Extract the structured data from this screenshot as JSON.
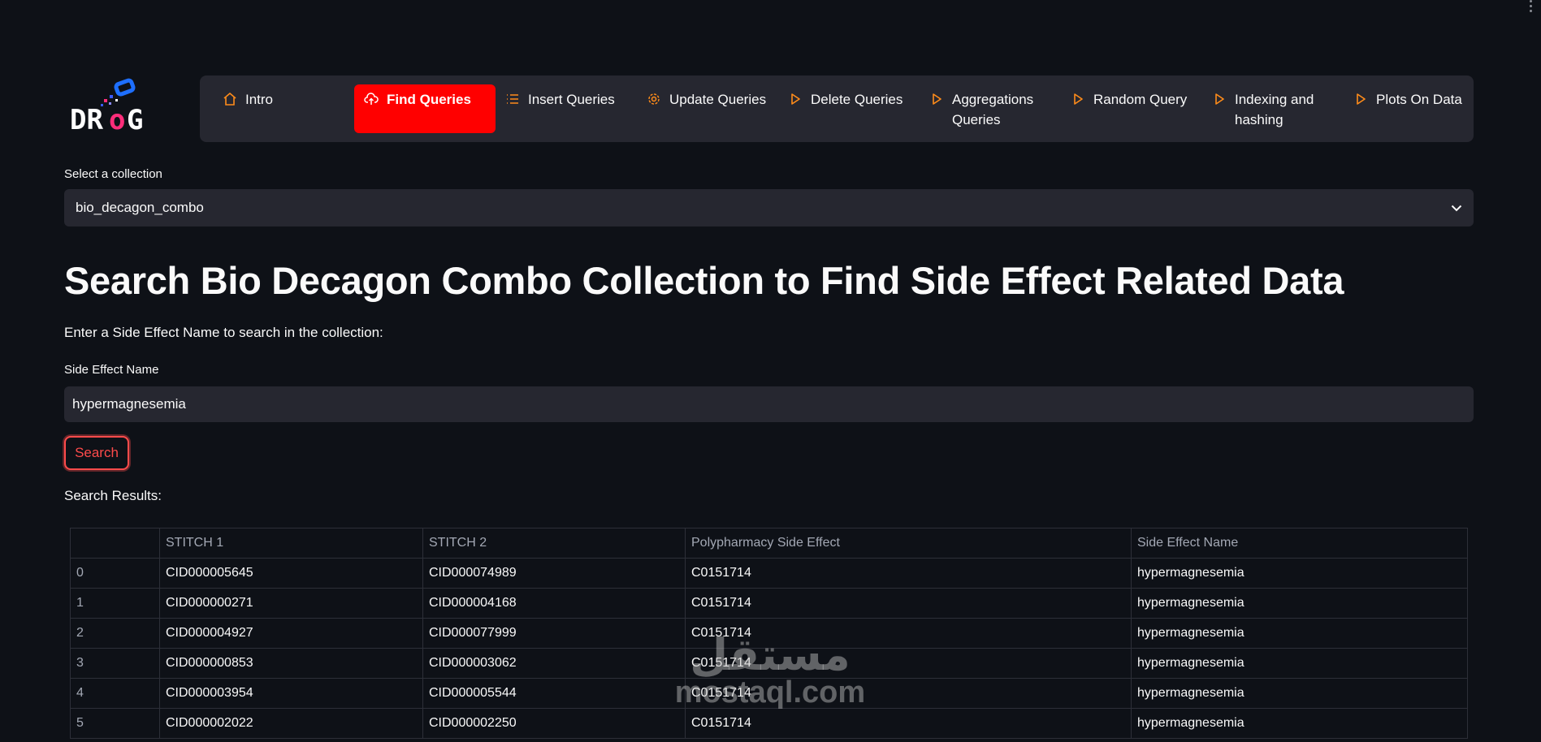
{
  "logo": {
    "text": "DRoG"
  },
  "nav": {
    "items": [
      {
        "label": "Intro",
        "icon": "house-icon",
        "active": false
      },
      {
        "label": "Find Queries",
        "icon": "cloud-upload-icon",
        "active": true
      },
      {
        "label": "Insert Queries",
        "icon": "list-icon",
        "active": false
      },
      {
        "label": "Update Queries",
        "icon": "gear-icon",
        "active": false
      },
      {
        "label": "Delete Queries",
        "icon": "play-icon",
        "active": false
      },
      {
        "label": "Aggregations Queries",
        "icon": "play-icon",
        "active": false
      },
      {
        "label": "Random Query",
        "icon": "play-icon",
        "active": false
      },
      {
        "label": "Indexing and hashing",
        "icon": "play-icon",
        "active": false
      },
      {
        "label": "Plots On Data",
        "icon": "play-icon",
        "active": false
      }
    ],
    "accent": "#ff0000",
    "icon_color": "#ff8c1a"
  },
  "collection": {
    "label": "Select a collection",
    "value": "bio_decagon_combo"
  },
  "main": {
    "title": "Search Bio Decagon Combo Collection to Find Side Effect Related Data",
    "prompt": "Enter a Side Effect Name to search in the collection:",
    "field_label": "Side Effect Name",
    "field_value": "hypermagnesemia",
    "search_label": "Search",
    "results_label": "Search Results:"
  },
  "table": {
    "columns": [
      "",
      "STITCH 1",
      "STITCH 2",
      "Polypharmacy Side Effect",
      "Side Effect Name"
    ],
    "rows": [
      [
        "0",
        "CID000005645",
        "CID000074989",
        "C0151714",
        "hypermagnesemia"
      ],
      [
        "1",
        "CID000000271",
        "CID000004168",
        "C0151714",
        "hypermagnesemia"
      ],
      [
        "2",
        "CID000004927",
        "CID000077999",
        "C0151714",
        "hypermagnesemia"
      ],
      [
        "3",
        "CID000000853",
        "CID000003062",
        "C0151714",
        "hypermagnesemia"
      ],
      [
        "4",
        "CID000003954",
        "CID000005544",
        "C0151714",
        "hypermagnesemia"
      ],
      [
        "5",
        "CID000002022",
        "CID000002250",
        "C0151714",
        "hypermagnesemia"
      ]
    ]
  },
  "watermark": {
    "arabic": "مستقل",
    "latin": "mostaql.com"
  }
}
